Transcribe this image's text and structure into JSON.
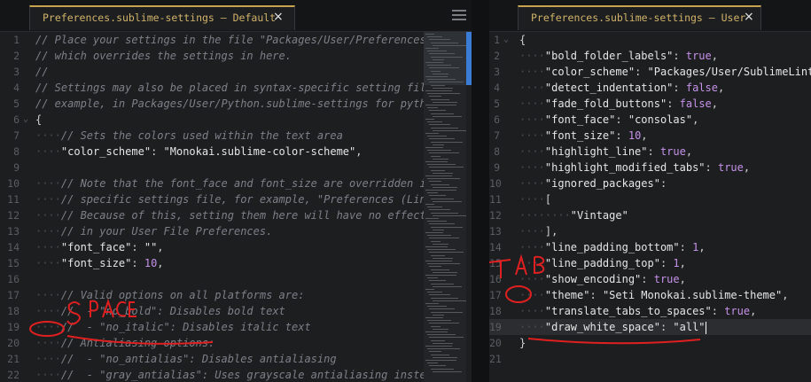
{
  "left_pane": {
    "tab_title": "Preferences.sublime-settings — Default",
    "close_glyph": "×",
    "lines": [
      {
        "n": "1",
        "fold": "",
        "parts": [
          [
            "cmt",
            "// Place your settings in the file \"Packages/User/Preferences"
          ]
        ]
      },
      {
        "n": "2",
        "fold": "",
        "parts": [
          [
            "cmt",
            "// which overrides the settings in here."
          ]
        ]
      },
      {
        "n": "3",
        "fold": "",
        "parts": [
          [
            "cmt",
            "//"
          ]
        ]
      },
      {
        "n": "4",
        "fold": "",
        "parts": [
          [
            "cmt",
            "// Settings may also be placed in syntax-specific setting fil"
          ]
        ]
      },
      {
        "n": "5",
        "fold": "",
        "parts": [
          [
            "cmt",
            "// example, in Packages/User/Python.sublime-settings for pyth"
          ]
        ]
      },
      {
        "n": "6",
        "fold": "v",
        "parts": [
          [
            "pun",
            "{"
          ]
        ]
      },
      {
        "n": "7",
        "fold": "",
        "parts": [
          [
            "ws",
            "····"
          ],
          [
            "cmt",
            "// Sets the colors used within the text area"
          ]
        ]
      },
      {
        "n": "8",
        "fold": "",
        "parts": [
          [
            "ws",
            "····"
          ],
          [
            "key",
            "\"color_scheme\""
          ],
          [
            "pun",
            ": "
          ],
          [
            "str",
            "\"Monokai.sublime-color-scheme\""
          ],
          [
            "pun",
            ","
          ]
        ]
      },
      {
        "n": "9",
        "fold": "",
        "parts": []
      },
      {
        "n": "10",
        "fold": "",
        "parts": [
          [
            "ws",
            "····"
          ],
          [
            "cmt",
            "// Note that the font_face and font_size are overridden i"
          ]
        ]
      },
      {
        "n": "11",
        "fold": "",
        "parts": [
          [
            "ws",
            "····"
          ],
          [
            "cmt",
            "// specific settings file, for example, \"Preferences (Lin"
          ]
        ]
      },
      {
        "n": "12",
        "fold": "",
        "parts": [
          [
            "ws",
            "····"
          ],
          [
            "cmt",
            "// Because of this, setting them here will have no effect"
          ]
        ]
      },
      {
        "n": "13",
        "fold": "",
        "parts": [
          [
            "ws",
            "····"
          ],
          [
            "cmt",
            "// in your User File Preferences."
          ]
        ]
      },
      {
        "n": "14",
        "fold": "",
        "parts": [
          [
            "ws",
            "····"
          ],
          [
            "key",
            "\"font_face\""
          ],
          [
            "pun",
            ": "
          ],
          [
            "str",
            "\"\""
          ],
          [
            "pun",
            ","
          ]
        ]
      },
      {
        "n": "15",
        "fold": "",
        "parts": [
          [
            "ws",
            "····"
          ],
          [
            "key",
            "\"font_size\""
          ],
          [
            "pun",
            ": "
          ],
          [
            "num",
            "10"
          ],
          [
            "pun",
            ","
          ]
        ]
      },
      {
        "n": "16",
        "fold": "",
        "parts": []
      },
      {
        "n": "17",
        "fold": "",
        "parts": [
          [
            "ws",
            "····"
          ],
          [
            "cmt",
            "// Valid options on all platforms are:"
          ]
        ]
      },
      {
        "n": "18",
        "fold": "",
        "parts": [
          [
            "ws",
            "····"
          ],
          [
            "cmt",
            "//  - \"no_bold\": Disables bold text"
          ]
        ]
      },
      {
        "n": "19",
        "fold": "",
        "parts": [
          [
            "ws",
            "····"
          ],
          [
            "cmt",
            "//  - \"no_italic\": Disables italic text"
          ]
        ]
      },
      {
        "n": "20",
        "fold": "",
        "parts": [
          [
            "ws",
            "····"
          ],
          [
            "cmt",
            "// Antialiasing options:"
          ]
        ]
      },
      {
        "n": "21",
        "fold": "",
        "parts": [
          [
            "ws",
            "····"
          ],
          [
            "cmt",
            "//  - \"no_antialias\": Disables antialiasing"
          ]
        ]
      },
      {
        "n": "22",
        "fold": "",
        "parts": [
          [
            "ws",
            "····"
          ],
          [
            "cmt",
            "//  - \"gray_antialias\": Uses grayscale antialiasing inste"
          ]
        ]
      }
    ]
  },
  "right_pane": {
    "tab_title": "Preferences.sublime-settings — User",
    "close_glyph": "×",
    "lines": [
      {
        "n": "1",
        "fold": "v",
        "parts": [
          [
            "pun",
            "{"
          ]
        ]
      },
      {
        "n": "2",
        "fold": "",
        "parts": [
          [
            "ws",
            "····"
          ],
          [
            "key",
            "\"bold_folder_labels\""
          ],
          [
            "pun",
            ": "
          ],
          [
            "bool",
            "true"
          ],
          [
            "pun",
            ","
          ]
        ]
      },
      {
        "n": "3",
        "fold": "",
        "parts": [
          [
            "ws",
            "····"
          ],
          [
            "key",
            "\"color_scheme\""
          ],
          [
            "pun",
            ": "
          ],
          [
            "str",
            "\"Packages/User/SublimeLint"
          ]
        ]
      },
      {
        "n": "4",
        "fold": "",
        "parts": [
          [
            "ws",
            "····"
          ],
          [
            "key",
            "\"detect_indentation\""
          ],
          [
            "pun",
            ": "
          ],
          [
            "bool",
            "false"
          ],
          [
            "pun",
            ","
          ]
        ]
      },
      {
        "n": "5",
        "fold": "",
        "parts": [
          [
            "ws",
            "····"
          ],
          [
            "key",
            "\"fade_fold_buttons\""
          ],
          [
            "pun",
            ": "
          ],
          [
            "bool",
            "false"
          ],
          [
            "pun",
            ","
          ]
        ]
      },
      {
        "n": "6",
        "fold": "",
        "parts": [
          [
            "ws",
            "····"
          ],
          [
            "key",
            "\"font_face\""
          ],
          [
            "pun",
            ": "
          ],
          [
            "str",
            "\"consolas\""
          ],
          [
            "pun",
            ","
          ]
        ]
      },
      {
        "n": "7",
        "fold": "",
        "parts": [
          [
            "ws",
            "····"
          ],
          [
            "key",
            "\"font_size\""
          ],
          [
            "pun",
            ": "
          ],
          [
            "num",
            "10"
          ],
          [
            "pun",
            ","
          ]
        ]
      },
      {
        "n": "8",
        "fold": "",
        "parts": [
          [
            "ws",
            "····"
          ],
          [
            "key",
            "\"highlight_line\""
          ],
          [
            "pun",
            ": "
          ],
          [
            "bool",
            "true"
          ],
          [
            "pun",
            ","
          ]
        ]
      },
      {
        "n": "9",
        "fold": "",
        "parts": [
          [
            "ws",
            "····"
          ],
          [
            "key",
            "\"highlight_modified_tabs\""
          ],
          [
            "pun",
            ": "
          ],
          [
            "bool",
            "true"
          ],
          [
            "pun",
            ","
          ]
        ]
      },
      {
        "n": "10",
        "fold": "",
        "parts": [
          [
            "ws",
            "····"
          ],
          [
            "key",
            "\"ignored_packages\""
          ],
          [
            "pun",
            ":"
          ]
        ]
      },
      {
        "n": "11",
        "fold": "",
        "parts": [
          [
            "ws",
            "····"
          ],
          [
            "pun",
            "["
          ]
        ]
      },
      {
        "n": "12",
        "fold": "",
        "parts": [
          [
            "ws",
            "········"
          ],
          [
            "str",
            "\"Vintage\""
          ]
        ]
      },
      {
        "n": "13",
        "fold": "",
        "parts": [
          [
            "ws",
            "····"
          ],
          [
            "pun",
            "],"
          ]
        ]
      },
      {
        "n": "14",
        "fold": "",
        "parts": [
          [
            "ws",
            "····"
          ],
          [
            "key",
            "\"line_padding_bottom\""
          ],
          [
            "pun",
            ": "
          ],
          [
            "num",
            "1"
          ],
          [
            "pun",
            ","
          ]
        ]
      },
      {
        "n": "15",
        "fold": "",
        "parts": [
          [
            "ws",
            "····"
          ],
          [
            "key",
            "\"line_padding_top\""
          ],
          [
            "pun",
            ": "
          ],
          [
            "num",
            "1"
          ],
          [
            "pun",
            ","
          ]
        ]
      },
      {
        "n": "16",
        "fold": "",
        "parts": [
          [
            "ws",
            "····"
          ],
          [
            "key",
            "\"show_encoding\""
          ],
          [
            "pun",
            ": "
          ],
          [
            "bool",
            "true"
          ],
          [
            "pun",
            ","
          ]
        ]
      },
      {
        "n": "17",
        "fold": "",
        "parts": [
          [
            "ws",
            "····"
          ],
          [
            "key",
            "\"theme\""
          ],
          [
            "pun",
            ": "
          ],
          [
            "str",
            "\"Seti Monokai.sublime-theme\""
          ],
          [
            "pun",
            ","
          ]
        ]
      },
      {
        "n": "18",
        "fold": "",
        "parts": [
          [
            "ws",
            "····"
          ],
          [
            "key",
            "\"translate_tabs_to_spaces\""
          ],
          [
            "pun",
            ": "
          ],
          [
            "bool",
            "true"
          ],
          [
            "pun",
            ","
          ]
        ]
      },
      {
        "n": "19",
        "fold": "",
        "parts": [
          [
            "ws",
            "····"
          ],
          [
            "key",
            "\"draw_white_space\""
          ],
          [
            "pun",
            ": "
          ],
          [
            "str",
            "\"all\""
          ]
        ]
      },
      {
        "n": "20",
        "fold": "",
        "parts": [
          [
            "pun",
            "}"
          ]
        ]
      },
      {
        "n": "21",
        "fold": "",
        "parts": []
      }
    ],
    "current_line_index": 18,
    "modified_marker": "«»"
  },
  "annotations": {
    "space_label": "SPACE",
    "tab_label": "TAB",
    "color": "#e02020"
  }
}
